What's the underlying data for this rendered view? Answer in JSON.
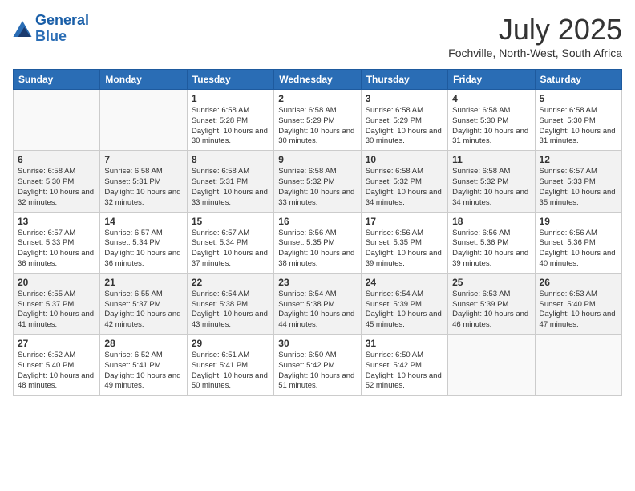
{
  "logo": {
    "line1": "General",
    "line2": "Blue"
  },
  "title": "July 2025",
  "subtitle": "Fochville, North-West, South Africa",
  "days_header": [
    "Sunday",
    "Monday",
    "Tuesday",
    "Wednesday",
    "Thursday",
    "Friday",
    "Saturday"
  ],
  "weeks": [
    [
      {
        "day": "",
        "info": ""
      },
      {
        "day": "",
        "info": ""
      },
      {
        "day": "1",
        "info": "Sunrise: 6:58 AM\nSunset: 5:28 PM\nDaylight: 10 hours and 30 minutes."
      },
      {
        "day": "2",
        "info": "Sunrise: 6:58 AM\nSunset: 5:29 PM\nDaylight: 10 hours and 30 minutes."
      },
      {
        "day": "3",
        "info": "Sunrise: 6:58 AM\nSunset: 5:29 PM\nDaylight: 10 hours and 30 minutes."
      },
      {
        "day": "4",
        "info": "Sunrise: 6:58 AM\nSunset: 5:30 PM\nDaylight: 10 hours and 31 minutes."
      },
      {
        "day": "5",
        "info": "Sunrise: 6:58 AM\nSunset: 5:30 PM\nDaylight: 10 hours and 31 minutes."
      }
    ],
    [
      {
        "day": "6",
        "info": "Sunrise: 6:58 AM\nSunset: 5:30 PM\nDaylight: 10 hours and 32 minutes."
      },
      {
        "day": "7",
        "info": "Sunrise: 6:58 AM\nSunset: 5:31 PM\nDaylight: 10 hours and 32 minutes."
      },
      {
        "day": "8",
        "info": "Sunrise: 6:58 AM\nSunset: 5:31 PM\nDaylight: 10 hours and 33 minutes."
      },
      {
        "day": "9",
        "info": "Sunrise: 6:58 AM\nSunset: 5:32 PM\nDaylight: 10 hours and 33 minutes."
      },
      {
        "day": "10",
        "info": "Sunrise: 6:58 AM\nSunset: 5:32 PM\nDaylight: 10 hours and 34 minutes."
      },
      {
        "day": "11",
        "info": "Sunrise: 6:58 AM\nSunset: 5:32 PM\nDaylight: 10 hours and 34 minutes."
      },
      {
        "day": "12",
        "info": "Sunrise: 6:57 AM\nSunset: 5:33 PM\nDaylight: 10 hours and 35 minutes."
      }
    ],
    [
      {
        "day": "13",
        "info": "Sunrise: 6:57 AM\nSunset: 5:33 PM\nDaylight: 10 hours and 36 minutes."
      },
      {
        "day": "14",
        "info": "Sunrise: 6:57 AM\nSunset: 5:34 PM\nDaylight: 10 hours and 36 minutes."
      },
      {
        "day": "15",
        "info": "Sunrise: 6:57 AM\nSunset: 5:34 PM\nDaylight: 10 hours and 37 minutes."
      },
      {
        "day": "16",
        "info": "Sunrise: 6:56 AM\nSunset: 5:35 PM\nDaylight: 10 hours and 38 minutes."
      },
      {
        "day": "17",
        "info": "Sunrise: 6:56 AM\nSunset: 5:35 PM\nDaylight: 10 hours and 39 minutes."
      },
      {
        "day": "18",
        "info": "Sunrise: 6:56 AM\nSunset: 5:36 PM\nDaylight: 10 hours and 39 minutes."
      },
      {
        "day": "19",
        "info": "Sunrise: 6:56 AM\nSunset: 5:36 PM\nDaylight: 10 hours and 40 minutes."
      }
    ],
    [
      {
        "day": "20",
        "info": "Sunrise: 6:55 AM\nSunset: 5:37 PM\nDaylight: 10 hours and 41 minutes."
      },
      {
        "day": "21",
        "info": "Sunrise: 6:55 AM\nSunset: 5:37 PM\nDaylight: 10 hours and 42 minutes."
      },
      {
        "day": "22",
        "info": "Sunrise: 6:54 AM\nSunset: 5:38 PM\nDaylight: 10 hours and 43 minutes."
      },
      {
        "day": "23",
        "info": "Sunrise: 6:54 AM\nSunset: 5:38 PM\nDaylight: 10 hours and 44 minutes."
      },
      {
        "day": "24",
        "info": "Sunrise: 6:54 AM\nSunset: 5:39 PM\nDaylight: 10 hours and 45 minutes."
      },
      {
        "day": "25",
        "info": "Sunrise: 6:53 AM\nSunset: 5:39 PM\nDaylight: 10 hours and 46 minutes."
      },
      {
        "day": "26",
        "info": "Sunrise: 6:53 AM\nSunset: 5:40 PM\nDaylight: 10 hours and 47 minutes."
      }
    ],
    [
      {
        "day": "27",
        "info": "Sunrise: 6:52 AM\nSunset: 5:40 PM\nDaylight: 10 hours and 48 minutes."
      },
      {
        "day": "28",
        "info": "Sunrise: 6:52 AM\nSunset: 5:41 PM\nDaylight: 10 hours and 49 minutes."
      },
      {
        "day": "29",
        "info": "Sunrise: 6:51 AM\nSunset: 5:41 PM\nDaylight: 10 hours and 50 minutes."
      },
      {
        "day": "30",
        "info": "Sunrise: 6:50 AM\nSunset: 5:42 PM\nDaylight: 10 hours and 51 minutes."
      },
      {
        "day": "31",
        "info": "Sunrise: 6:50 AM\nSunset: 5:42 PM\nDaylight: 10 hours and 52 minutes."
      },
      {
        "day": "",
        "info": ""
      },
      {
        "day": "",
        "info": ""
      }
    ]
  ]
}
